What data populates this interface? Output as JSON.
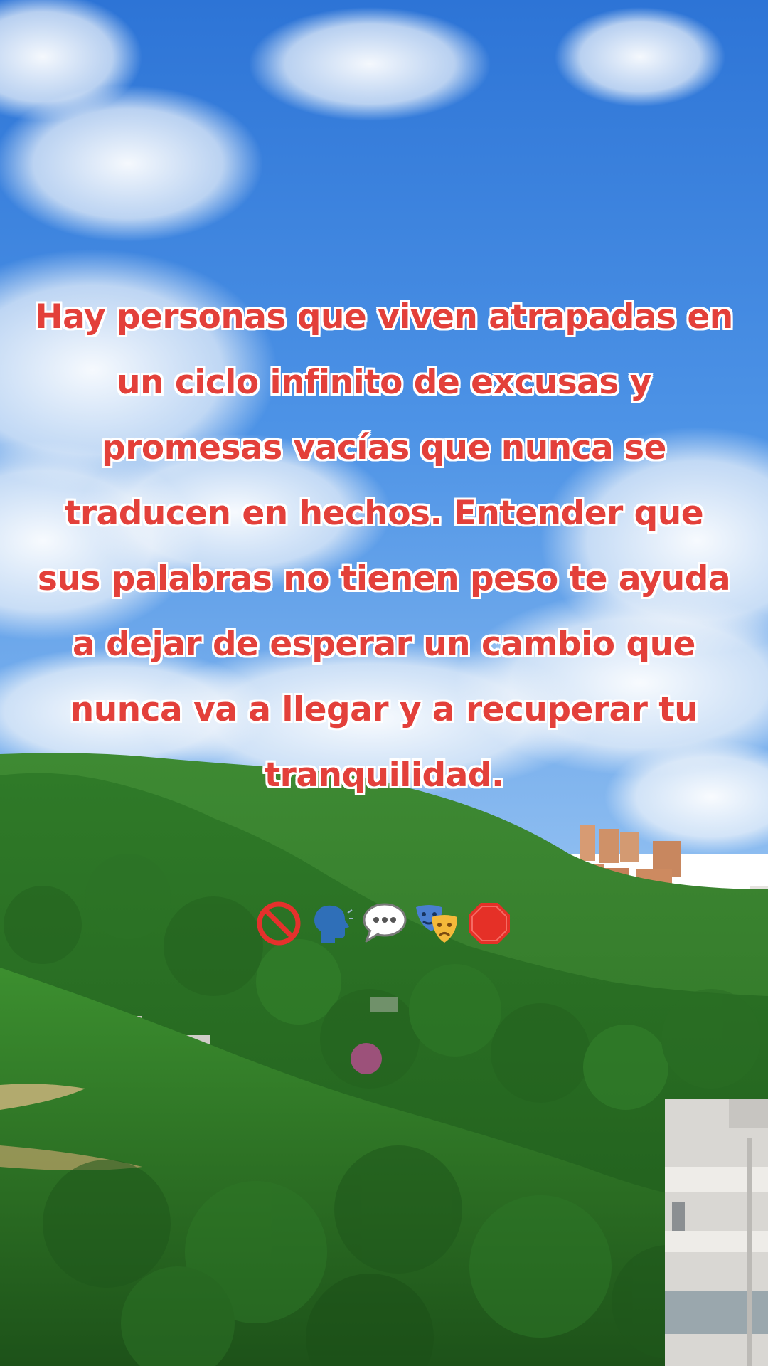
{
  "overlay": {
    "quote": "Hay personas que viven atrapadas en un ciclo infinito de excusas y promesas vacías que nunca se traducen en hechos. Entender que sus palabras no tienen peso te ayuda a dejar de esperar un cambio que nunca va a llegar y a recuperar tu tranquilidad.",
    "text_color": "#e3403a",
    "outline_color": "#ffffff"
  },
  "emojis": [
    {
      "name": "prohibited-icon"
    },
    {
      "name": "speaking-head-icon"
    },
    {
      "name": "speech-balloon-icon"
    },
    {
      "name": "performing-arts-icon"
    },
    {
      "name": "stop-sign-icon"
    }
  ],
  "background": {
    "subject": "blue sky with clouds over green forested hills and buildings",
    "sky_color": "#3a86df",
    "foliage_color": "#2f7d2a"
  }
}
